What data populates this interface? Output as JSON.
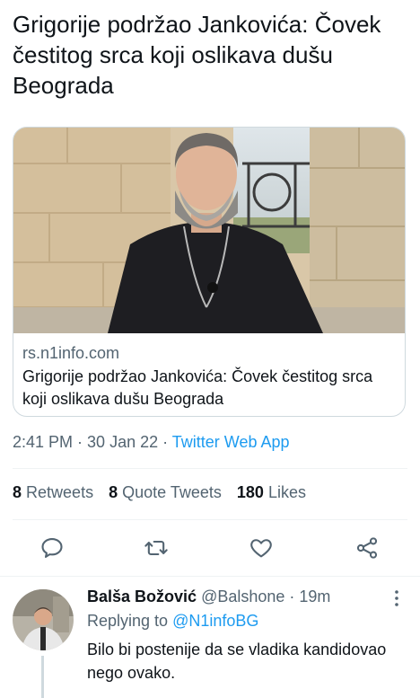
{
  "tweet": {
    "text": "Grigorije podržao Jankovića: Čovek čestitog srca koji oslikava dušu Beograda"
  },
  "card": {
    "image_icon": "photo-priest-icon",
    "domain": "rs.n1info.com",
    "title": "Grigorije podržao Jankovića: Čovek čestitog srca koji oslikava dušu Beograda"
  },
  "meta": {
    "time": "2:41 PM",
    "dot1": " · ",
    "date": "30 Jan 22",
    "dot2": " · ",
    "source": "Twitter Web App"
  },
  "stats": {
    "retweets_count": "8",
    "retweets_label": "Retweets",
    "quotes_count": "8",
    "quotes_label": "Quote Tweets",
    "likes_count": "180",
    "likes_label": "Likes"
  },
  "actions": {
    "reply_icon": "reply-icon",
    "retweet_icon": "retweet-icon",
    "like_icon": "heart-icon",
    "share_icon": "share-icon"
  },
  "reply": {
    "name": "Balša Božović",
    "handle": "@Balshone",
    "dot": " · ",
    "time": "19m",
    "replying_to_label": "Replying to ",
    "replying_to_mention": "@N1infoBG",
    "text": "Bilo bi postenije da se vladika kandidovao nego ovako."
  },
  "colors": {
    "link": "#1d9bf0",
    "secondary_text": "#536471",
    "primary_text": "#0f1419",
    "border": "#cfd9de"
  }
}
